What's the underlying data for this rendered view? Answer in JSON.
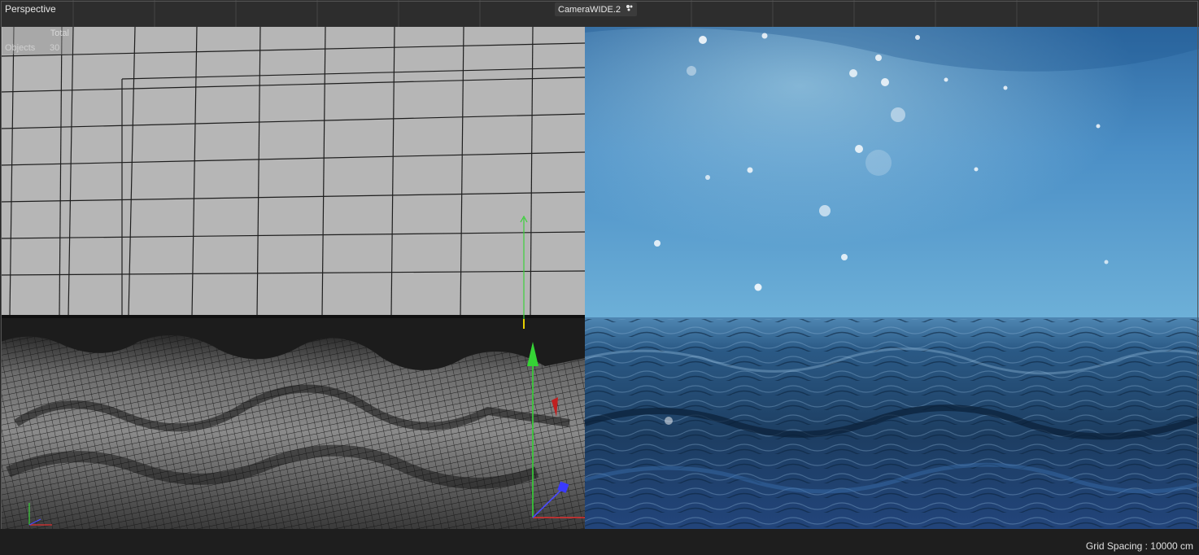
{
  "viewport": {
    "view_name": "Perspective",
    "camera_name": "CameraWIDE.2",
    "camera_icon": "camera-switch-icon",
    "hud": {
      "column_header": "Total",
      "row_label": "Objects",
      "row_value": "30"
    },
    "grid_spacing_text": "Grid Spacing : 10000 cm"
  },
  "colors": {
    "viewport_bg": "#b6b6b6",
    "mesh_dark": "#1c1c1c",
    "sky_top": "#2b6ea8",
    "sky_horizon": "#7fbfe0",
    "sea": "#1e3d63",
    "axis_y": "#35d335",
    "axis_x": "#e03030",
    "axis_z": "#3a3aff"
  }
}
